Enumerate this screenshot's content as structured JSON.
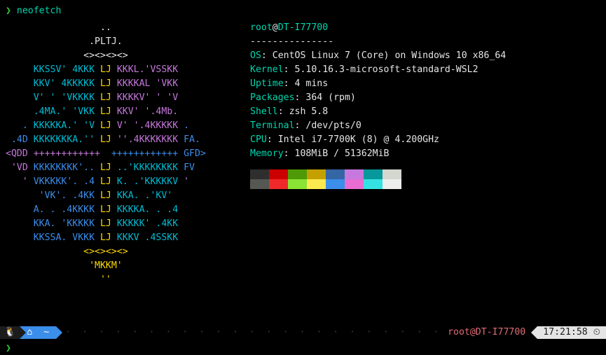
{
  "cmdline": {
    "sign": "❯",
    "command": "neofetch"
  },
  "logo": {
    "lines": [
      [
        [
          "white",
          "                 .."
        ]
      ],
      [
        [
          "white",
          "               .PLTJ."
        ]
      ],
      [
        [
          "white",
          "              <><><><>"
        ]
      ],
      [
        [
          "cyan",
          "     KKSSV' 4KKK "
        ],
        [
          "yellow",
          "LJ "
        ],
        [
          "magenta",
          "KKKL.'VSSKK"
        ]
      ],
      [
        [
          "cyan",
          "     KKV' 4KKKKK "
        ],
        [
          "yellow",
          "LJ "
        ],
        [
          "magenta",
          "KKKKAL 'VKK"
        ]
      ],
      [
        [
          "cyan",
          "     V' ' 'VKKKK "
        ],
        [
          "yellow",
          "LJ "
        ],
        [
          "magenta",
          "KKKKV' ' 'V"
        ]
      ],
      [
        [
          "cyan",
          "     .4MA.' 'VKK "
        ],
        [
          "yellow",
          "LJ "
        ],
        [
          "magenta",
          "KKV' '.4Mb."
        ]
      ],
      [
        [
          "blue",
          "   . "
        ],
        [
          "cyan",
          "KKKKKA.' 'V "
        ],
        [
          "yellow",
          "LJ "
        ],
        [
          "magenta",
          "V' '.4KKKKK "
        ],
        [
          "blue",
          "."
        ]
      ],
      [
        [
          "blue",
          " .4D "
        ],
        [
          "cyan",
          "KKKKKKKA.'' "
        ],
        [
          "yellow",
          "LJ "
        ],
        [
          "magenta",
          "''.4KKKKKKK "
        ],
        [
          "blue",
          "FA."
        ]
      ],
      [
        [
          "magenta",
          "<QDD ++++++++++++  "
        ],
        [
          "blue",
          "++++++++++++ GFD>"
        ]
      ],
      [
        [
          "magenta",
          " 'VD "
        ],
        [
          "blue",
          "KKKKKKKK'.. "
        ],
        [
          "yellow",
          "LJ "
        ],
        [
          "cyan",
          "..'KKKKKKKK "
        ],
        [
          "blue",
          "FV "
        ]
      ],
      [
        [
          "magenta",
          "   ' "
        ],
        [
          "blue",
          "VKKKKK'. .4 "
        ],
        [
          "yellow",
          "LJ "
        ],
        [
          "cyan",
          "K. .'KKKKKV "
        ],
        [
          "magenta",
          "' "
        ]
      ],
      [
        [
          "blue",
          "      'VK'. .4KK "
        ],
        [
          "yellow",
          "LJ "
        ],
        [
          "cyan",
          "KKA. .'KV'  "
        ]
      ],
      [
        [
          "blue",
          "     A. . .4KKKK "
        ],
        [
          "yellow",
          "LJ "
        ],
        [
          "cyan",
          "KKKKA. . .4"
        ]
      ],
      [
        [
          "blue",
          "     KKA. 'KKKKK "
        ],
        [
          "yellow",
          "LJ "
        ],
        [
          "cyan",
          "KKKKK' .4KK"
        ]
      ],
      [
        [
          "blue",
          "     KKSSA. VKKK "
        ],
        [
          "yellow",
          "LJ "
        ],
        [
          "cyan",
          "KKKV .4SSKK"
        ]
      ],
      [
        [
          "yellow",
          "              <><><><>"
        ]
      ],
      [
        [
          "yellow",
          "               'MKKM'"
        ]
      ],
      [
        [
          "yellow",
          "                 ''"
        ]
      ]
    ]
  },
  "info": {
    "userhost": {
      "user": "root",
      "sep": "@",
      "host": "DT-I77700"
    },
    "separator": "---------------",
    "lines": [
      {
        "label": "OS",
        "value": "CentOS Linux 7 (Core) on Windows 10 x86_64"
      },
      {
        "label": "Kernel",
        "value": "5.10.16.3-microsoft-standard-WSL2"
      },
      {
        "label": "Uptime",
        "value": "4 mins"
      },
      {
        "label": "Packages",
        "value": "364 (rpm)"
      },
      {
        "label": "Shell",
        "value": "zsh 5.8"
      },
      {
        "label": "Terminal",
        "value": "/dev/pts/0"
      },
      {
        "label": "CPU",
        "value": "Intel i7-7700K (8) @ 4.200GHz"
      },
      {
        "label": "Memory",
        "value": "108MiB / 51362MiB"
      }
    ],
    "palette": {
      "row1": [
        "#2e2e2e",
        "#cc0000",
        "#4e9a06",
        "#c4a000",
        "#3465a4",
        "#c678dd",
        "#06989a",
        "#d3d7cf"
      ],
      "row2": [
        "#555753",
        "#ef2929",
        "#8ae234",
        "#fce94f",
        "#3b8eea",
        "#e86cd1",
        "#34e2e2",
        "#eeeeec"
      ]
    }
  },
  "status": {
    "os_icon": "🐧",
    "home_icon": "⌂",
    "tilde": "~",
    "userhost": "root@DT-I77700",
    "time": "17:21:58",
    "time_icon": "⏲"
  },
  "bottom_prompt": "❯"
}
